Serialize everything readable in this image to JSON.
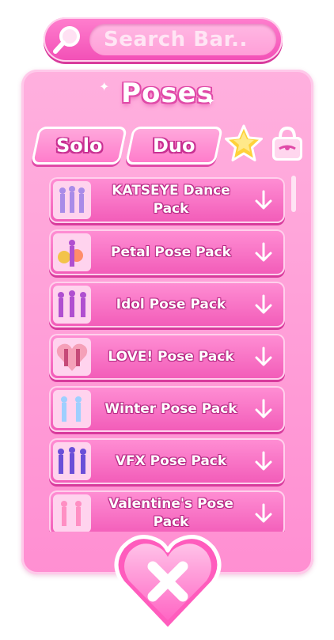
{
  "search": {
    "placeholder": "Search Bar..",
    "icon": "magnifier-icon"
  },
  "panel": {
    "title": "Poses"
  },
  "tabs": [
    {
      "label": "Solo",
      "active": false
    },
    {
      "label": "Duo",
      "active": true
    }
  ],
  "filter_icons": [
    "star-icon",
    "shopping-bag-icon"
  ],
  "pose_packs": [
    {
      "label": "KATSEYE Dance Pack",
      "thumb_color": "#a98be8",
      "icon": "down-arrow-icon"
    },
    {
      "label": "Petal Pose Pack",
      "thumb_color": "#f3c34a",
      "icon": "down-arrow-icon"
    },
    {
      "label": "Idol Pose Pack",
      "thumb_color": "#b04fd0",
      "icon": "down-arrow-icon"
    },
    {
      "label": "LOVE! Pose Pack",
      "thumb_color": "#e86a8a",
      "icon": "down-arrow-icon"
    },
    {
      "label": "Winter Pose Pack",
      "thumb_color": "#9ecfff",
      "icon": "down-arrow-icon"
    },
    {
      "label": "VFX Pose Pack",
      "thumb_color": "#6a4fd8",
      "icon": "down-arrow-icon"
    },
    {
      "label": "Valentine's Pose Pack",
      "thumb_color": "#ff8fc3",
      "icon": "down-arrow-icon"
    }
  ],
  "close_button": {
    "icon": "close-x-icon",
    "shape": "heart"
  },
  "colors": {
    "primary_pink": "#ff7fce",
    "dark_pink": "#d83a9c",
    "light_pink": "#ffd0ec",
    "star_yellow": "#ffd23a"
  }
}
